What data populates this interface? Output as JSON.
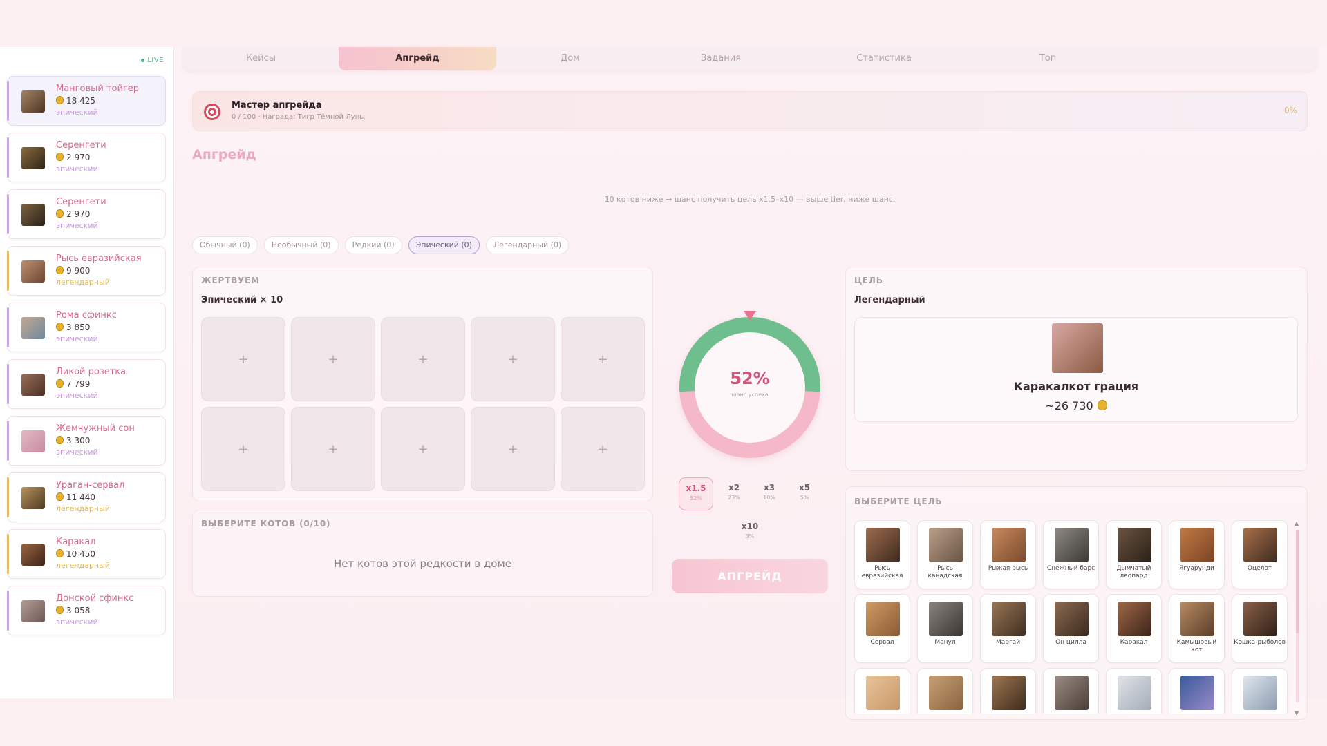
{
  "feed": {
    "live_label": "LIVE",
    "items": [
      {
        "name": "Манговый тойгер",
        "price": "18 425",
        "rarity": "эпический",
        "tier": "epic",
        "c1": "#a48262",
        "c2": "#4d3626"
      },
      {
        "name": "Серенгети",
        "price": "2 970",
        "rarity": "эпический",
        "tier": "epic",
        "c1": "#8a6a3e",
        "c2": "#2e2418"
      },
      {
        "name": "Серенгети",
        "price": "2 970",
        "rarity": "эпический",
        "tier": "epic",
        "c1": "#7c6240",
        "c2": "#2b2219"
      },
      {
        "name": "Рысь евразийская",
        "price": "9 900",
        "rarity": "легендарный",
        "tier": "leg",
        "c1": "#c0906e",
        "c2": "#6a4634"
      },
      {
        "name": "Рома сфинкс",
        "price": "3 850",
        "rarity": "эпический",
        "tier": "epic",
        "c1": "#c5a690",
        "c2": "#6d8aa0"
      },
      {
        "name": "Ликой розетка",
        "price": "7 799",
        "rarity": "эпический",
        "tier": "epic",
        "c1": "#9a6e58",
        "c2": "#4a3024"
      },
      {
        "name": "Жемчужный сон",
        "price": "3 300",
        "rarity": "эпический",
        "tier": "epic",
        "c1": "#e4b8c4",
        "c2": "#c48ca0"
      },
      {
        "name": "Ураган-сервал",
        "price": "11 440",
        "rarity": "легендарный",
        "tier": "leg",
        "c1": "#b8925e",
        "c2": "#4e3a22"
      },
      {
        "name": "Каракал",
        "price": "10 450",
        "rarity": "легендарный",
        "tier": "leg",
        "c1": "#9c6440",
        "c2": "#3c2418"
      },
      {
        "name": "Донской сфинкс",
        "price": "3 058",
        "rarity": "эпический",
        "tier": "epic",
        "c1": "#b49c96",
        "c2": "#6c5a56"
      }
    ]
  },
  "tabs": [
    "Кейсы",
    "Апгрейд",
    "Дом",
    "Задания",
    "Статистика",
    "Топ"
  ],
  "banner": {
    "title": "Мастер апгрейда",
    "subtitle": "0 / 100 · Награда: Тигр Тёмной Луны",
    "percent": "0%"
  },
  "upgrade": {
    "title": "Апгрейд",
    "hint": "10 котов ниже → шанс получить цель x1.5–x10 — выше tier, ниже шанс.",
    "rarity_chips": [
      {
        "label": "Обычный (0)",
        "active": false
      },
      {
        "label": "Необычный (0)",
        "active": false
      },
      {
        "label": "Редкий (0)",
        "active": false
      },
      {
        "label": "Эпический (0)",
        "active": true
      },
      {
        "label": "Легендарный (0)",
        "active": false
      }
    ]
  },
  "sacrifice": {
    "label": "ЖЕРТВУЕМ",
    "sub": "Эпический × 10",
    "slot_symbol": "+",
    "slot_count": 10
  },
  "select_cats": {
    "label": "ВЫБЕРИТЕ КОТОВ",
    "count": "(0/10)",
    "empty_message": "Нет котов этой редкости в доме"
  },
  "ring": {
    "chance_percent": 52,
    "percent_label": "52%",
    "sub_label": "шанс успеха",
    "success_color": "#6fbf8e",
    "fail_color": "#f4b8c8"
  },
  "multipliers": [
    {
      "label": "x1.5",
      "chance": "52%",
      "active": true
    },
    {
      "label": "x2",
      "chance": "23%",
      "active": false
    },
    {
      "label": "x3",
      "chance": "10%",
      "active": false
    },
    {
      "label": "x5",
      "chance": "5%",
      "active": false
    },
    {
      "label": "x10",
      "chance": "3%",
      "active": false
    }
  ],
  "upgrade_button": "АПГРЕЙД",
  "target": {
    "label": "ЦЕЛЬ",
    "rarity": "Легендарный",
    "name": "Каракалкот грация",
    "price": "~26 730"
  },
  "choose_target": {
    "label": "ВЫБЕРИТЕ ЦЕЛЬ",
    "cats": [
      {
        "name": "Рысь евразийская",
        "c1": "#9c6c4c",
        "c2": "#3e2a20"
      },
      {
        "name": "Рысь канадская",
        "c1": "#b8a08a",
        "c2": "#6a5444"
      },
      {
        "name": "Рыжая рысь",
        "c1": "#c88a5c",
        "c2": "#7a4a2e"
      },
      {
        "name": "Снежный барс",
        "c1": "#8e8a86",
        "c2": "#3c3834"
      },
      {
        "name": "Дымчатый леопард",
        "c1": "#6a5440",
        "c2": "#2a2018"
      },
      {
        "name": "Ягуарунди",
        "c1": "#c07a44",
        "c2": "#7a4426"
      },
      {
        "name": "Оцелот",
        "c1": "#a8704a",
        "c2": "#3e2a1e"
      },
      {
        "name": "Сервал",
        "c1": "#d09a64",
        "c2": "#8a5a34"
      },
      {
        "name": "Манул",
        "c1": "#8a8480",
        "c2": "#3a3632"
      },
      {
        "name": "Маргай",
        "c1": "#9a7654",
        "c2": "#3e2e22"
      },
      {
        "name": "Он цилла",
        "c1": "#8c6a50",
        "c2": "#3a2a20"
      },
      {
        "name": "Каракал",
        "c1": "#a06848",
        "c2": "#3a2418"
      },
      {
        "name": "Камышовый кот",
        "c1": "#b88a62",
        "c2": "#5a3e2a"
      },
      {
        "name": "Кошка-рыболов",
        "c1": "#8a6048",
        "c2": "#2e2018"
      },
      {
        "name": "",
        "c1": "#e8c49a",
        "c2": "#c89868"
      },
      {
        "name": "",
        "c1": "#c8a074",
        "c2": "#8a6440"
      },
      {
        "name": "",
        "c1": "#9e7650",
        "c2": "#3e2c1e"
      },
      {
        "name": "",
        "c1": "#9a8c84",
        "c2": "#4a3e38"
      },
      {
        "name": "",
        "c1": "#e0e4ea",
        "c2": "#a4acb6"
      },
      {
        "name": "",
        "c1": "#3a5a9a",
        "c2": "#9a8ac8"
      },
      {
        "name": "",
        "c1": "#dfe6ee",
        "c2": "#8c9cb0"
      }
    ]
  }
}
